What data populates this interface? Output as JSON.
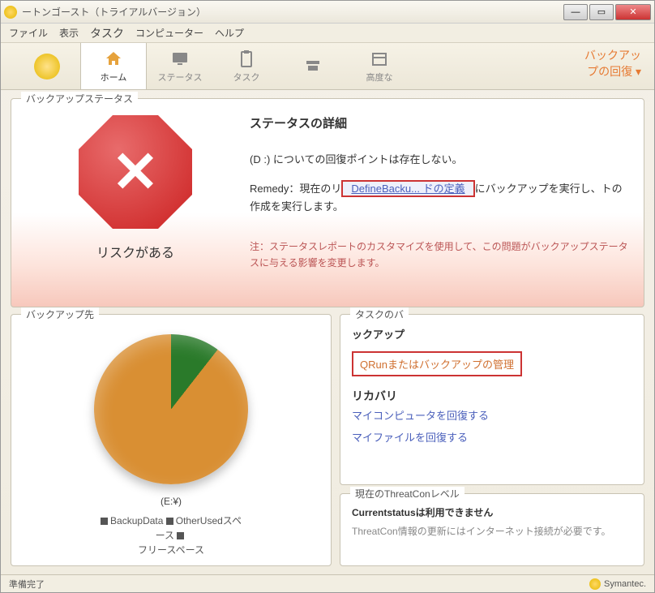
{
  "title": "ートンゴースト（トライアルバージョン）",
  "menu": {
    "file": "ファイル",
    "view": "表示",
    "task": "タスク",
    "computer": "コンピューター",
    "help": "ヘルプ"
  },
  "toolbar": {
    "home": "ホーム",
    "status": "ステータス",
    "task": "タスク",
    "empty": "",
    "advanced": "高度な"
  },
  "rightlink": {
    "l1": "バックアッ",
    "l2": "プの回復"
  },
  "status_panel": {
    "title": "バックアップステータス",
    "risk": "リスクがある",
    "heading": "ステータスの詳細",
    "line1": "(D :) についての回復ポイントは存在しない。",
    "remedy_prefix": "Remedy：現在のリ",
    "remedy_link": "DefineBacku... ドの定義",
    "remedy_suffix": "にバックアップを実行し、トの作成を実行します。",
    "note": "注：ステータスレポートのカスタマイズを使用して、この問題がバックアップステータスに与える影響を変更します。"
  },
  "dest_panel": {
    "title": "バックアップ先",
    "drive": "(E:¥)",
    "legend1": "BackupData",
    "legend2": "OtherUsedスペース",
    "legend3": "フリースペース"
  },
  "tasks_panel": {
    "title": "タスクのバ",
    "backup_label": "ックアップ",
    "run_link": "QRunまたはバックアップの管理",
    "recovery_label": "リカバリ",
    "recover_pc": "マイコンピュータを回復する",
    "recover_files": "マイファイルを回復する"
  },
  "threat_panel": {
    "title": "現在のThreatConレベル",
    "status": "Currentstatusは利用できません",
    "info": "ThreatCon情報の更新にはインターネット接続が必要です。"
  },
  "statusbar": {
    "ready": "準備完了",
    "brand": "Symantec."
  },
  "chart_data": {
    "type": "pie",
    "title": "(E:¥)",
    "series": [
      {
        "name": "BackupData",
        "value": 8,
        "color": "#d98f33"
      },
      {
        "name": "OtherUsedスペース",
        "value": 3,
        "color": "#2a7a2a"
      },
      {
        "name": "フリースペース",
        "value": 89,
        "color": "#d98f33"
      }
    ]
  }
}
